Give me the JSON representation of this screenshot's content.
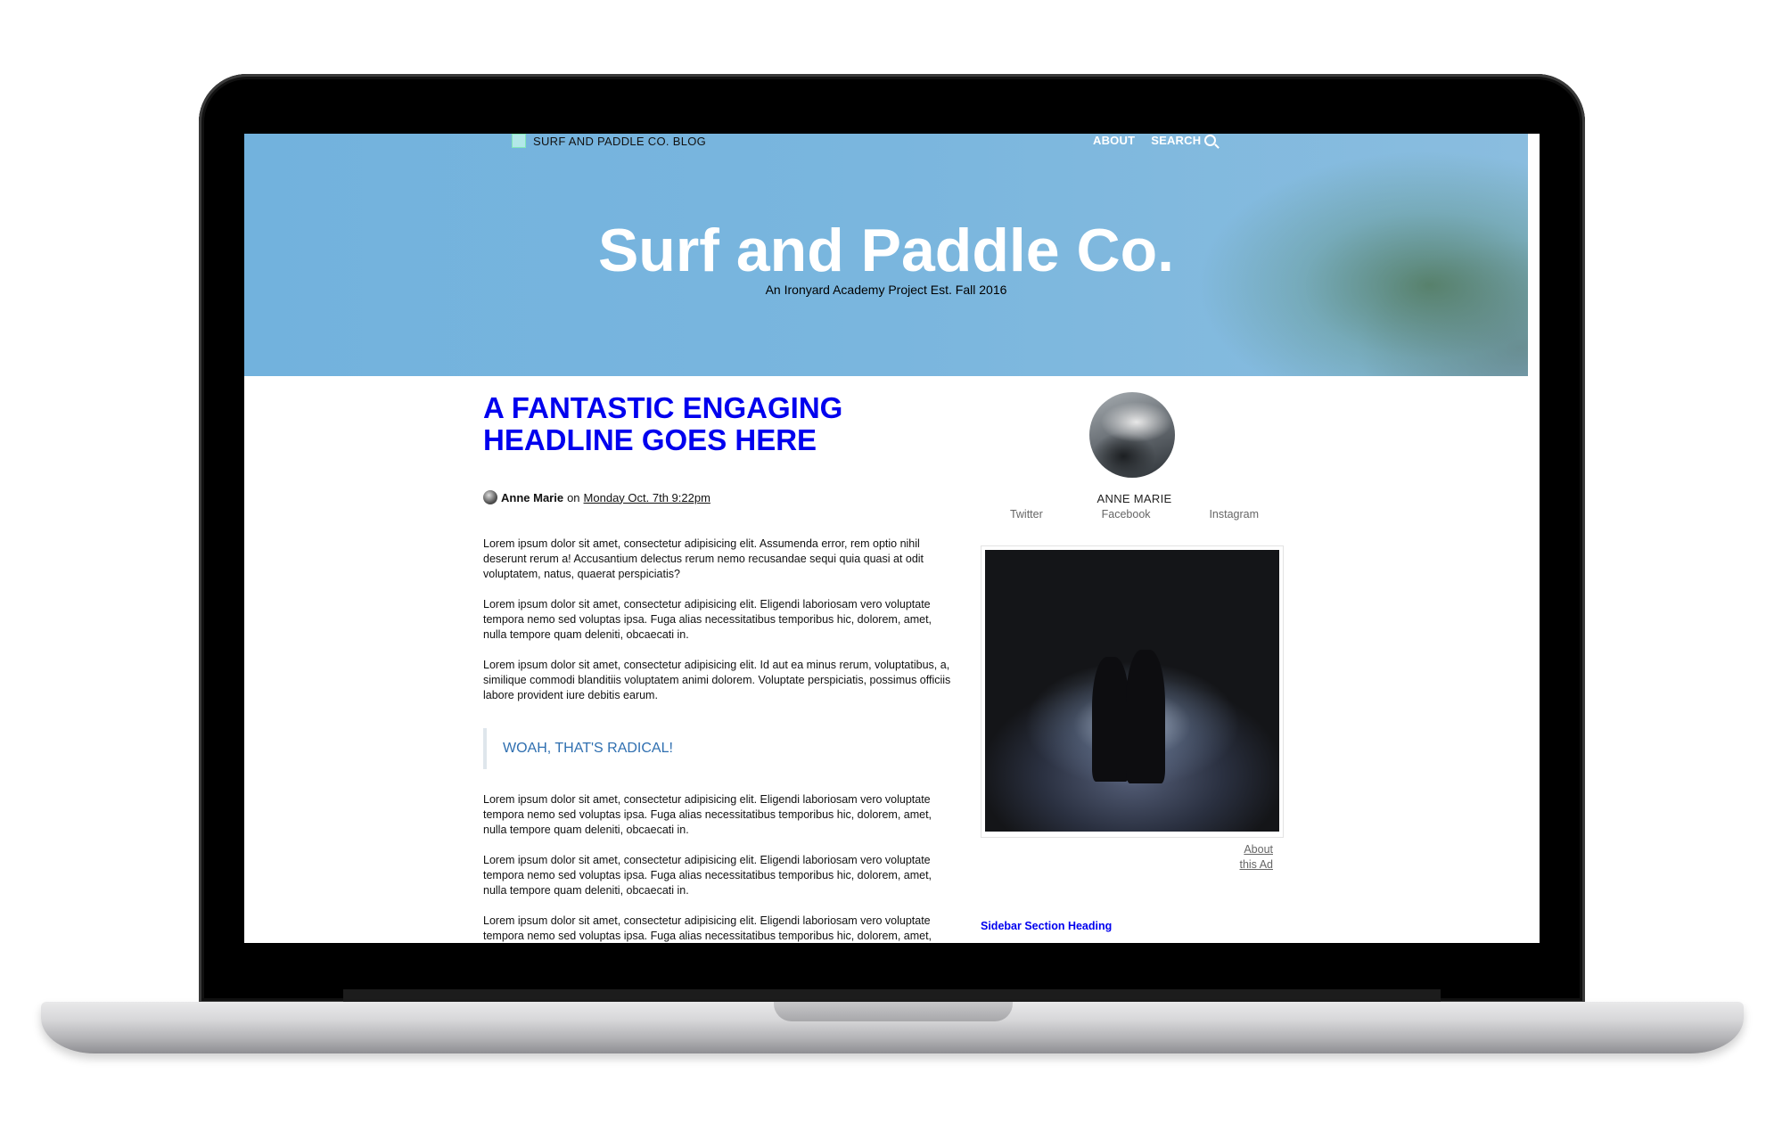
{
  "site": {
    "brand": "SURF AND PADDLE CO. BLOG",
    "nav": {
      "about": "ABOUT",
      "search": "SEARCH"
    },
    "title": "Surf and Paddle Co.",
    "tagline": "An Ironyard Academy Project Est. Fall 2016"
  },
  "article": {
    "headline": "A FANTASTIC ENGAGING HEADLINE GOES HERE",
    "byline": {
      "author": "Anne Marie",
      "on": "on",
      "date": "Monday Oct. 7th 9:22pm"
    },
    "paragraphs_top": [
      "Lorem ipsum dolor sit amet, consectetur adipisicing elit. Assumenda error, rem optio nihil deserunt rerum a! Accusantium delectus rerum nemo recusandae sequi quia quasi at odit voluptatem, natus, quaerat perspiciatis?",
      "Lorem ipsum dolor sit amet, consectetur adipisicing elit. Eligendi laboriosam vero voluptate tempora nemo sed voluptas ipsa. Fuga alias necessitatibus temporibus hic, dolorem, amet, nulla tempore quam deleniti, obcaecati in.",
      "Lorem ipsum dolor sit amet, consectetur adipisicing elit. Id aut ea minus rerum, voluptatibus, a, similique commodi blanditiis voluptatem animi dolorem. Voluptate perspiciatis, possimus officiis labore provident iure debitis earum."
    ],
    "pullquote": "WOAH, THAT'S RADICAL!",
    "paragraphs_bottom": [
      "Lorem ipsum dolor sit amet, consectetur adipisicing elit. Eligendi laboriosam vero voluptate tempora nemo sed voluptas ipsa. Fuga alias necessitatibus temporibus hic, dolorem, amet, nulla tempore quam deleniti, obcaecati in.",
      "Lorem ipsum dolor sit amet, consectetur adipisicing elit. Eligendi laboriosam vero voluptate tempora nemo sed voluptas ipsa. Fuga alias necessitatibus temporibus hic, dolorem, amet, nulla tempore quam deleniti, obcaecati in.",
      "Lorem ipsum dolor sit amet, consectetur adipisicing elit. Eligendi laboriosam vero voluptate tempora nemo sed voluptas ipsa. Fuga alias necessitatibus temporibus hic, dolorem, amet, nulla tempore quam deleniti, obcaecati in."
    ]
  },
  "sidebar": {
    "profile_name": "ANNE MARIE",
    "social": [
      "Twitter",
      "Facebook",
      "Instagram"
    ],
    "ad_about_line1": "About",
    "ad_about_line2": "this Ad",
    "section_heading": "Sidebar Section Heading"
  },
  "colors": {
    "link_blue": "#0000ee",
    "pullquote_blue": "#2f6fb0",
    "hero_sky": "#7ab6de"
  }
}
